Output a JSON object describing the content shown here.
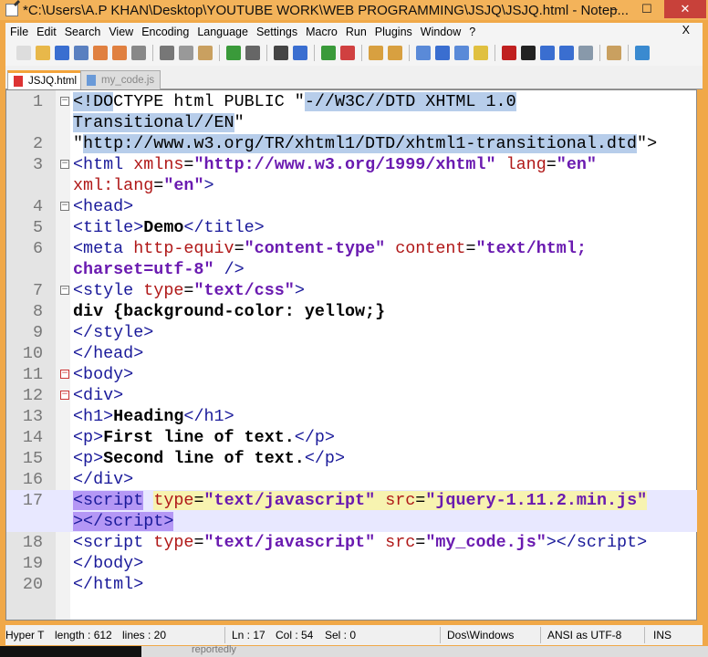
{
  "window": {
    "title": "*C:\\Users\\A.P KHAN\\Desktop\\YOUTUBE WORK\\WEB PROGRAMMING\\JSJQ\\JSJQ.html - Notep...",
    "minimize": "–",
    "maximize": "☐",
    "close": "✕"
  },
  "menu": [
    "File",
    "Edit",
    "Search",
    "View",
    "Encoding",
    "Language",
    "Settings",
    "Macro",
    "Run",
    "Plugins",
    "Window",
    "?"
  ],
  "menu_close": "X",
  "toolbar": [
    "new",
    "open",
    "save",
    "save-all",
    "close",
    "close-all",
    "print",
    "cut",
    "copy",
    "paste",
    "undo",
    "redo",
    "find",
    "replace",
    "zoom-in",
    "zoom-out",
    "sync-v",
    "sync-h",
    "word-wrap",
    "show-all-chars",
    "indent-guide",
    "user-lang",
    "record",
    "stop",
    "play",
    "run-multiple",
    "save-macro",
    "launch",
    "spellcheck"
  ],
  "tabs": [
    {
      "label": "JSJQ.html",
      "active": true
    },
    {
      "label": "my_code.js",
      "active": false
    }
  ],
  "code": [
    {
      "n": "1",
      "fold": "box",
      "t": [
        [
          "t-plain sel",
          "<!DO"
        ],
        [
          "t-plain",
          "CTYPE html PUBLIC \""
        ],
        [
          "t-plain sel",
          "-//W3C//DTD XHTML 1.0"
        ]
      ]
    },
    {
      "n": "",
      "t": [
        [
          "t-plain sel",
          "Transitional//EN"
        ],
        [
          "t-plain",
          "\""
        ]
      ]
    },
    {
      "n": "2",
      "t": [
        [
          "t-plain",
          "\""
        ],
        [
          "t-plain sel",
          "http://www.w3.org/TR/xhtml1/DTD/xhtml1-transitional.dtd"
        ],
        [
          "t-plain",
          "\">"
        ]
      ]
    },
    {
      "n": "3",
      "fold": "box",
      "t": [
        [
          "t-tag",
          "<html "
        ],
        [
          "t-attr",
          "xmlns"
        ],
        [
          "t-plain",
          "="
        ],
        [
          "t-val",
          "\"http://www.w3.org/1999/xhtml\""
        ],
        [
          "t-plain",
          " "
        ],
        [
          "t-attr",
          "lang"
        ],
        [
          "t-plain",
          "="
        ],
        [
          "t-val",
          "\"en\""
        ]
      ]
    },
    {
      "n": "",
      "t": [
        [
          "t-attr",
          "xml:lang"
        ],
        [
          "t-plain",
          "="
        ],
        [
          "t-val",
          "\"en\""
        ],
        [
          "t-tag",
          ">"
        ]
      ]
    },
    {
      "n": "4",
      "fold": "box",
      "t": [
        [
          "t-tag",
          "<head>"
        ]
      ]
    },
    {
      "n": "5",
      "t": [
        [
          "t-tag",
          "<title>"
        ],
        [
          "t-bold",
          "Demo"
        ],
        [
          "t-tag",
          "</title>"
        ]
      ]
    },
    {
      "n": "6",
      "t": [
        [
          "t-tag",
          "<meta "
        ],
        [
          "t-attr",
          "http-equiv"
        ],
        [
          "t-plain",
          "="
        ],
        [
          "t-val",
          "\"content-type\""
        ],
        [
          "t-plain",
          " "
        ],
        [
          "t-attr",
          "content"
        ],
        [
          "t-plain",
          "="
        ],
        [
          "t-val",
          "\"text/html;"
        ]
      ]
    },
    {
      "n": "",
      "t": [
        [
          "t-val",
          "charset=utf-8\""
        ],
        [
          "t-plain",
          " "
        ],
        [
          "t-tag",
          "/>"
        ]
      ]
    },
    {
      "n": "7",
      "fold": "box",
      "t": [
        [
          "t-tag",
          "<style "
        ],
        [
          "t-attr",
          "type"
        ],
        [
          "t-plain",
          "="
        ],
        [
          "t-val",
          "\"text/css\""
        ],
        [
          "t-tag",
          ">"
        ]
      ]
    },
    {
      "n": "8",
      "t": [
        [
          "t-bold",
          "div {background-color: yellow;}"
        ]
      ]
    },
    {
      "n": "9",
      "t": [
        [
          "t-tag",
          "</style>"
        ]
      ]
    },
    {
      "n": "10",
      "t": [
        [
          "t-tag",
          "</head>"
        ]
      ]
    },
    {
      "n": "11",
      "fold": "red",
      "t": [
        [
          "t-tag",
          "<body>"
        ]
      ]
    },
    {
      "n": "12",
      "fold": "red",
      "t": [
        [
          "t-tag",
          "<div>"
        ]
      ]
    },
    {
      "n": "13",
      "t": [
        [
          "t-tag",
          "<h1>"
        ],
        [
          "t-bold",
          "Heading"
        ],
        [
          "t-tag",
          "</h1>"
        ]
      ]
    },
    {
      "n": "14",
      "t": [
        [
          "t-tag",
          "<p>"
        ],
        [
          "t-bold",
          "First line of text."
        ],
        [
          "t-tag",
          "</p>"
        ]
      ]
    },
    {
      "n": "15",
      "t": [
        [
          "t-tag",
          "<p>"
        ],
        [
          "t-bold",
          "Second line of text."
        ],
        [
          "t-tag",
          "</p>"
        ]
      ]
    },
    {
      "n": "16",
      "t": [
        [
          "t-tag",
          "</div>"
        ]
      ]
    },
    {
      "n": "17",
      "cur": true,
      "t": [
        [
          "t-tag hlp",
          "<script"
        ],
        [
          "t-plain",
          " "
        ],
        [
          "t-attr hly",
          "type"
        ],
        [
          "t-plain hly",
          "="
        ],
        [
          "t-val hly",
          "\"text/javascript\""
        ],
        [
          "t-plain hly",
          " "
        ],
        [
          "t-attr hly",
          "src"
        ],
        [
          "t-plain hly",
          "="
        ],
        [
          "t-val hly",
          "\"jquery-1.11.2.min.js\""
        ]
      ]
    },
    {
      "n": "",
      "cur": true,
      "t": [
        [
          "t-tag hlp",
          "></script>"
        ]
      ]
    },
    {
      "n": "18",
      "t": [
        [
          "t-tag",
          "<script "
        ],
        [
          "t-attr",
          "type"
        ],
        [
          "t-plain",
          "="
        ],
        [
          "t-val",
          "\"text/javascript\""
        ],
        [
          "t-plain",
          " "
        ],
        [
          "t-attr",
          "src"
        ],
        [
          "t-plain",
          "="
        ],
        [
          "t-val",
          "\"my_code.js\""
        ],
        [
          "t-tag",
          "></script>"
        ]
      ]
    },
    {
      "n": "19",
      "t": [
        [
          "t-tag",
          "</body>"
        ]
      ]
    },
    {
      "n": "20",
      "t": [
        [
          "t-tag",
          "</html>"
        ]
      ]
    }
  ],
  "status": {
    "type": "Hyper T",
    "length": "length : 612",
    "lines": "lines : 20",
    "ln": "Ln : 17",
    "col": "Col : 54",
    "sel": "Sel : 0",
    "eol": "Dos\\Windows",
    "encoding": "ANSI as UTF-8",
    "mode": "INS"
  },
  "background_text": "reportedly"
}
